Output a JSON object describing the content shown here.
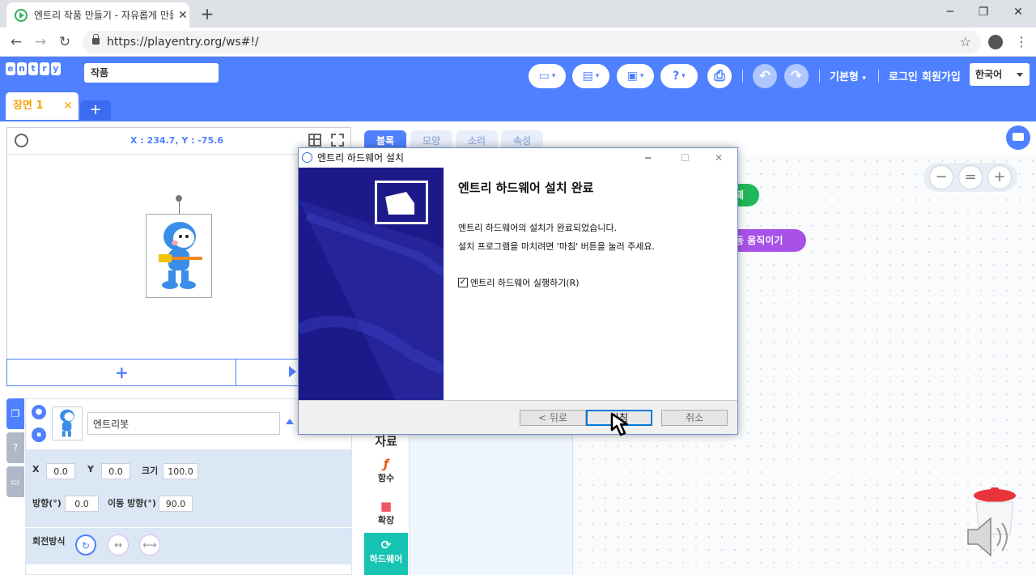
{
  "browser": {
    "tab_title": "엔트리 작품 만들기 - 자유롭게 만들기",
    "tab_close": "✕",
    "new_tab": "+",
    "url": "https://playentry.org/ws#!/",
    "window_controls": [
      "─",
      "❐",
      "✕"
    ]
  },
  "entry": {
    "logo_letters": [
      "e",
      "n",
      "t",
      "r",
      "y"
    ],
    "project_name": "작품",
    "mode_label": "기본형",
    "login_label": "로그인",
    "signup_label": "회원가입",
    "language": "한국어",
    "scene_tab": "장면 1",
    "scene_close": "✕",
    "add_scene": "+"
  },
  "stage": {
    "coords": "X : 234.7, Y : -75.6",
    "add_object": "+"
  },
  "object": {
    "name": "엔트리봇",
    "x_label": "X",
    "x_value": "0.0",
    "y_label": "Y",
    "y_value": "0.0",
    "size_label": "크기",
    "size_value": "100.0",
    "direction_label": "방향(°)",
    "direction_value": "0.0",
    "move_direction_label": "이동 방향(°)",
    "move_direction_value": "90.0",
    "rotation_label": "회전방식"
  },
  "block_tabs": [
    {
      "label": "블록"
    },
    {
      "label": "모양"
    },
    {
      "label": "소리"
    },
    {
      "label": "속성"
    }
  ],
  "categories": [
    {
      "label": "자료",
      "icon": ""
    },
    {
      "label": "함수",
      "icon": "ƒ"
    },
    {
      "label": "확장",
      "icon": "■"
    },
    {
      "label": "하드웨어",
      "icon": "⟳"
    }
  ],
  "board": {
    "block_partial_1": "제",
    "block_partial_2": "동 움직이기",
    "zoom_out": "−",
    "zoom_reset": "=",
    "zoom_in": "+"
  },
  "dialog": {
    "title": "엔트리 하드웨어 설치",
    "heading": "엔트리 하드웨어 설치 완료",
    "line1": "엔트리 하드웨어의 설치가 완료되었습니다.",
    "line2": "설치 프로그램을 마치려면 '마침' 버튼을 눌러 주세요.",
    "checkbox_label": "엔트리 하드웨어 실행하기(R)",
    "checkbox_checked": true,
    "back_button": "< 뒤로",
    "finish_button": "마침",
    "cancel_button": "취소",
    "controls": [
      "─",
      "☐",
      "✕"
    ]
  },
  "colors": {
    "entry_blue": "#4f80ff",
    "scene_orange": "#f9a10d",
    "hardware_teal": "#17c3b2",
    "installer_navy": "#1a168f"
  }
}
